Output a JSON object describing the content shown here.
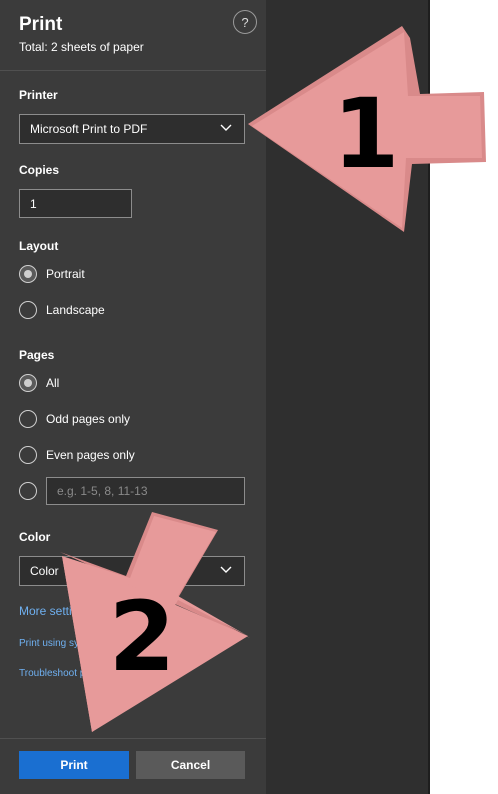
{
  "header": {
    "title": "Print",
    "subtitle": "Total: 2 sheets of paper",
    "help_glyph": "?"
  },
  "printer": {
    "label": "Printer",
    "selected": "Microsoft Print to PDF"
  },
  "copies": {
    "label": "Copies",
    "value": "1"
  },
  "layout": {
    "label": "Layout",
    "options": [
      "Portrait",
      "Landscape"
    ],
    "selected": "Portrait"
  },
  "pages": {
    "label": "Pages",
    "options": [
      "All",
      "Odd pages only",
      "Even pages only"
    ],
    "selected": "All",
    "custom_placeholder": "e.g. 1-5, 8, 11-13"
  },
  "color": {
    "label": "Color",
    "selected": "Color"
  },
  "links": {
    "more_settings": "More settings",
    "print_using_system": "Print using system dialog",
    "troubleshoot": "Troubleshoot printing"
  },
  "actions": {
    "print": "Print",
    "cancel": "Cancel"
  },
  "annotations": {
    "arrow1_number": "1",
    "arrow2_number": "2",
    "arrow_color": "#e79a9a"
  },
  "colors": {
    "panel_bg": "#3b3b3b",
    "primary_button": "#1a6fd1",
    "link": "#6fb0f0"
  }
}
